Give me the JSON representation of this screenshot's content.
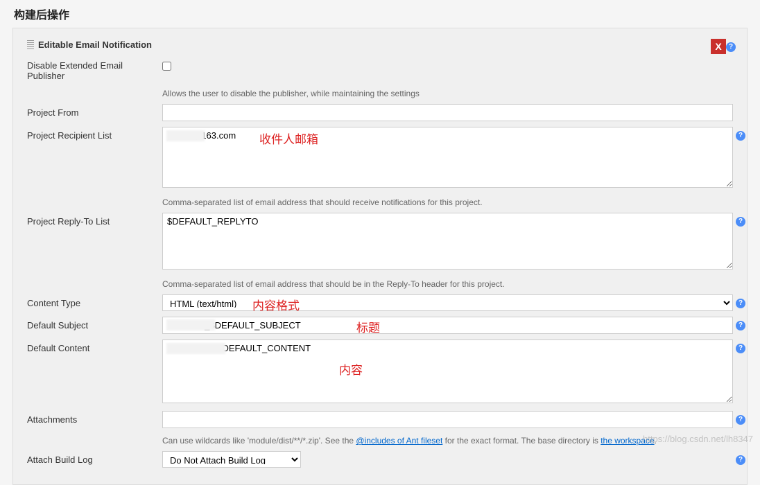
{
  "section_title": "构建后操作",
  "close_label": "X",
  "header": "Editable Email Notification",
  "labels": {
    "disable_publisher": "Disable Extended Email Publisher",
    "disable_help": "Allows the user to disable the publisher, while maintaining the settings",
    "project_from": "Project From",
    "recipient_list": "Project Recipient List",
    "recipient_help": "Comma-separated list of email address that should receive notifications for this project.",
    "replyto_list": "Project Reply-To List",
    "replyto_help": "Comma-separated list of email address that should be in the Reply-To header for this project.",
    "content_type": "Content Type",
    "default_subject": "Default Subject",
    "default_content": "Default Content",
    "attachments": "Attachments",
    "attachments_help_1": "Can use wildcards like 'module/dist/**/*.zip'. See the ",
    "attachments_link1": "@includes of Ant fileset",
    "attachments_help_2": " for the exact format. The base directory is ",
    "attachments_link2": "the workspace",
    "attachments_help_3": ".",
    "attach_log": "Attach Build Log"
  },
  "values": {
    "recipient": "          @163.com",
    "replyto": "$DEFAULT_REPLYTO",
    "content_type": "HTML (text/html)",
    "subject": "               _$DEFAULT_SUBJECT",
    "content": "                    $DEFAULT_CONTENT",
    "attach_log": "Do Not Attach Build Log"
  },
  "annotations": {
    "recipient": "收件人邮箱",
    "content_type": "内容格式",
    "subject": "标题",
    "content": "内容"
  },
  "watermark": "https://blog.csdn.net/lh8347"
}
